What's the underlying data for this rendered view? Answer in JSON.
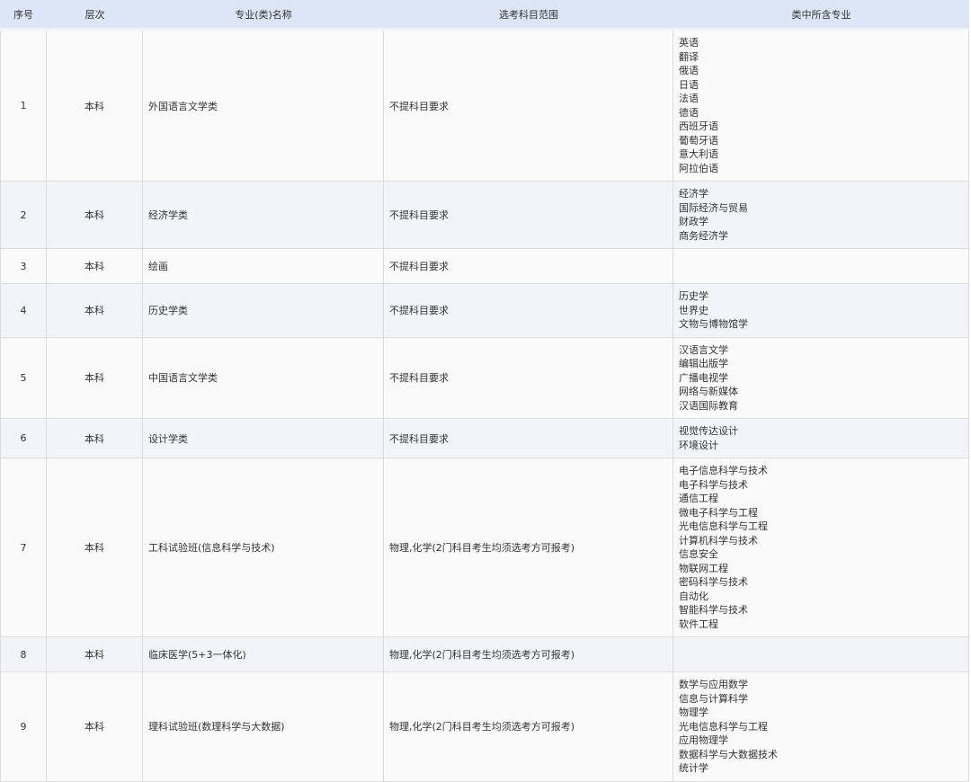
{
  "table": {
    "headers": [
      "序号",
      "层次",
      "专业(类)名称",
      "选考科目范围",
      "类中所含专业"
    ],
    "rows": [
      {
        "num": "1",
        "level": "本科",
        "name": "外国语言文学类",
        "requirement": "不提科目要求",
        "majors": [
          "英语",
          "翻译",
          "俄语",
          "日语",
          "法语",
          "德语",
          "西班牙语",
          "葡萄牙语",
          "意大利语",
          "阿拉伯语"
        ]
      },
      {
        "num": "2",
        "level": "本科",
        "name": "经济学类",
        "requirement": "不提科目要求",
        "majors": [
          "经济学",
          "国际经济与贸易",
          "财政学",
          "商务经济学"
        ]
      },
      {
        "num": "3",
        "level": "本科",
        "name": "绘画",
        "requirement": "不提科目要求",
        "majors": []
      },
      {
        "num": "4",
        "level": "本科",
        "name": "历史学类",
        "requirement": "不提科目要求",
        "majors": [
          "历史学",
          "世界史",
          "文物与博物馆学"
        ]
      },
      {
        "num": "5",
        "level": "本科",
        "name": "中国语言文学类",
        "requirement": "不提科目要求",
        "majors": [
          "汉语言文学",
          "编辑出版学",
          "广播电视学",
          "网络与新媒体",
          "汉语国际教育"
        ]
      },
      {
        "num": "6",
        "level": "本科",
        "name": "设计学类",
        "requirement": "不提科目要求",
        "majors": [
          "视觉传达设计",
          "环境设计"
        ]
      },
      {
        "num": "7",
        "level": "本科",
        "name": "工科试验班(信息科学与技术)",
        "requirement": "物理,化学(2门科目考生均须选考方可报考)",
        "majors": [
          "电子信息科学与技术",
          "电子科学与技术",
          "通信工程",
          "微电子科学与工程",
          "光电信息科学与工程",
          "计算机科学与技术",
          "信息安全",
          "物联网工程",
          "密码科学与技术",
          "自动化",
          "智能科学与技术",
          "软件工程"
        ]
      },
      {
        "num": "8",
        "level": "本科",
        "name": "临床医学(5+3一体化)",
        "requirement": "物理,化学(2门科目考生均须选考方可报考)",
        "majors": []
      },
      {
        "num": "9",
        "level": "本科",
        "name": "理科试验班(数理科学与大数据)",
        "requirement": "物理,化学(2门科目考生均须选考方可报考)",
        "majors": [
          "数学与应用数学",
          "信息与计算科学",
          "物理学",
          "光电信息科学与工程",
          "应用物理学",
          "数据科学与大数据技术",
          "统计学"
        ]
      }
    ]
  }
}
